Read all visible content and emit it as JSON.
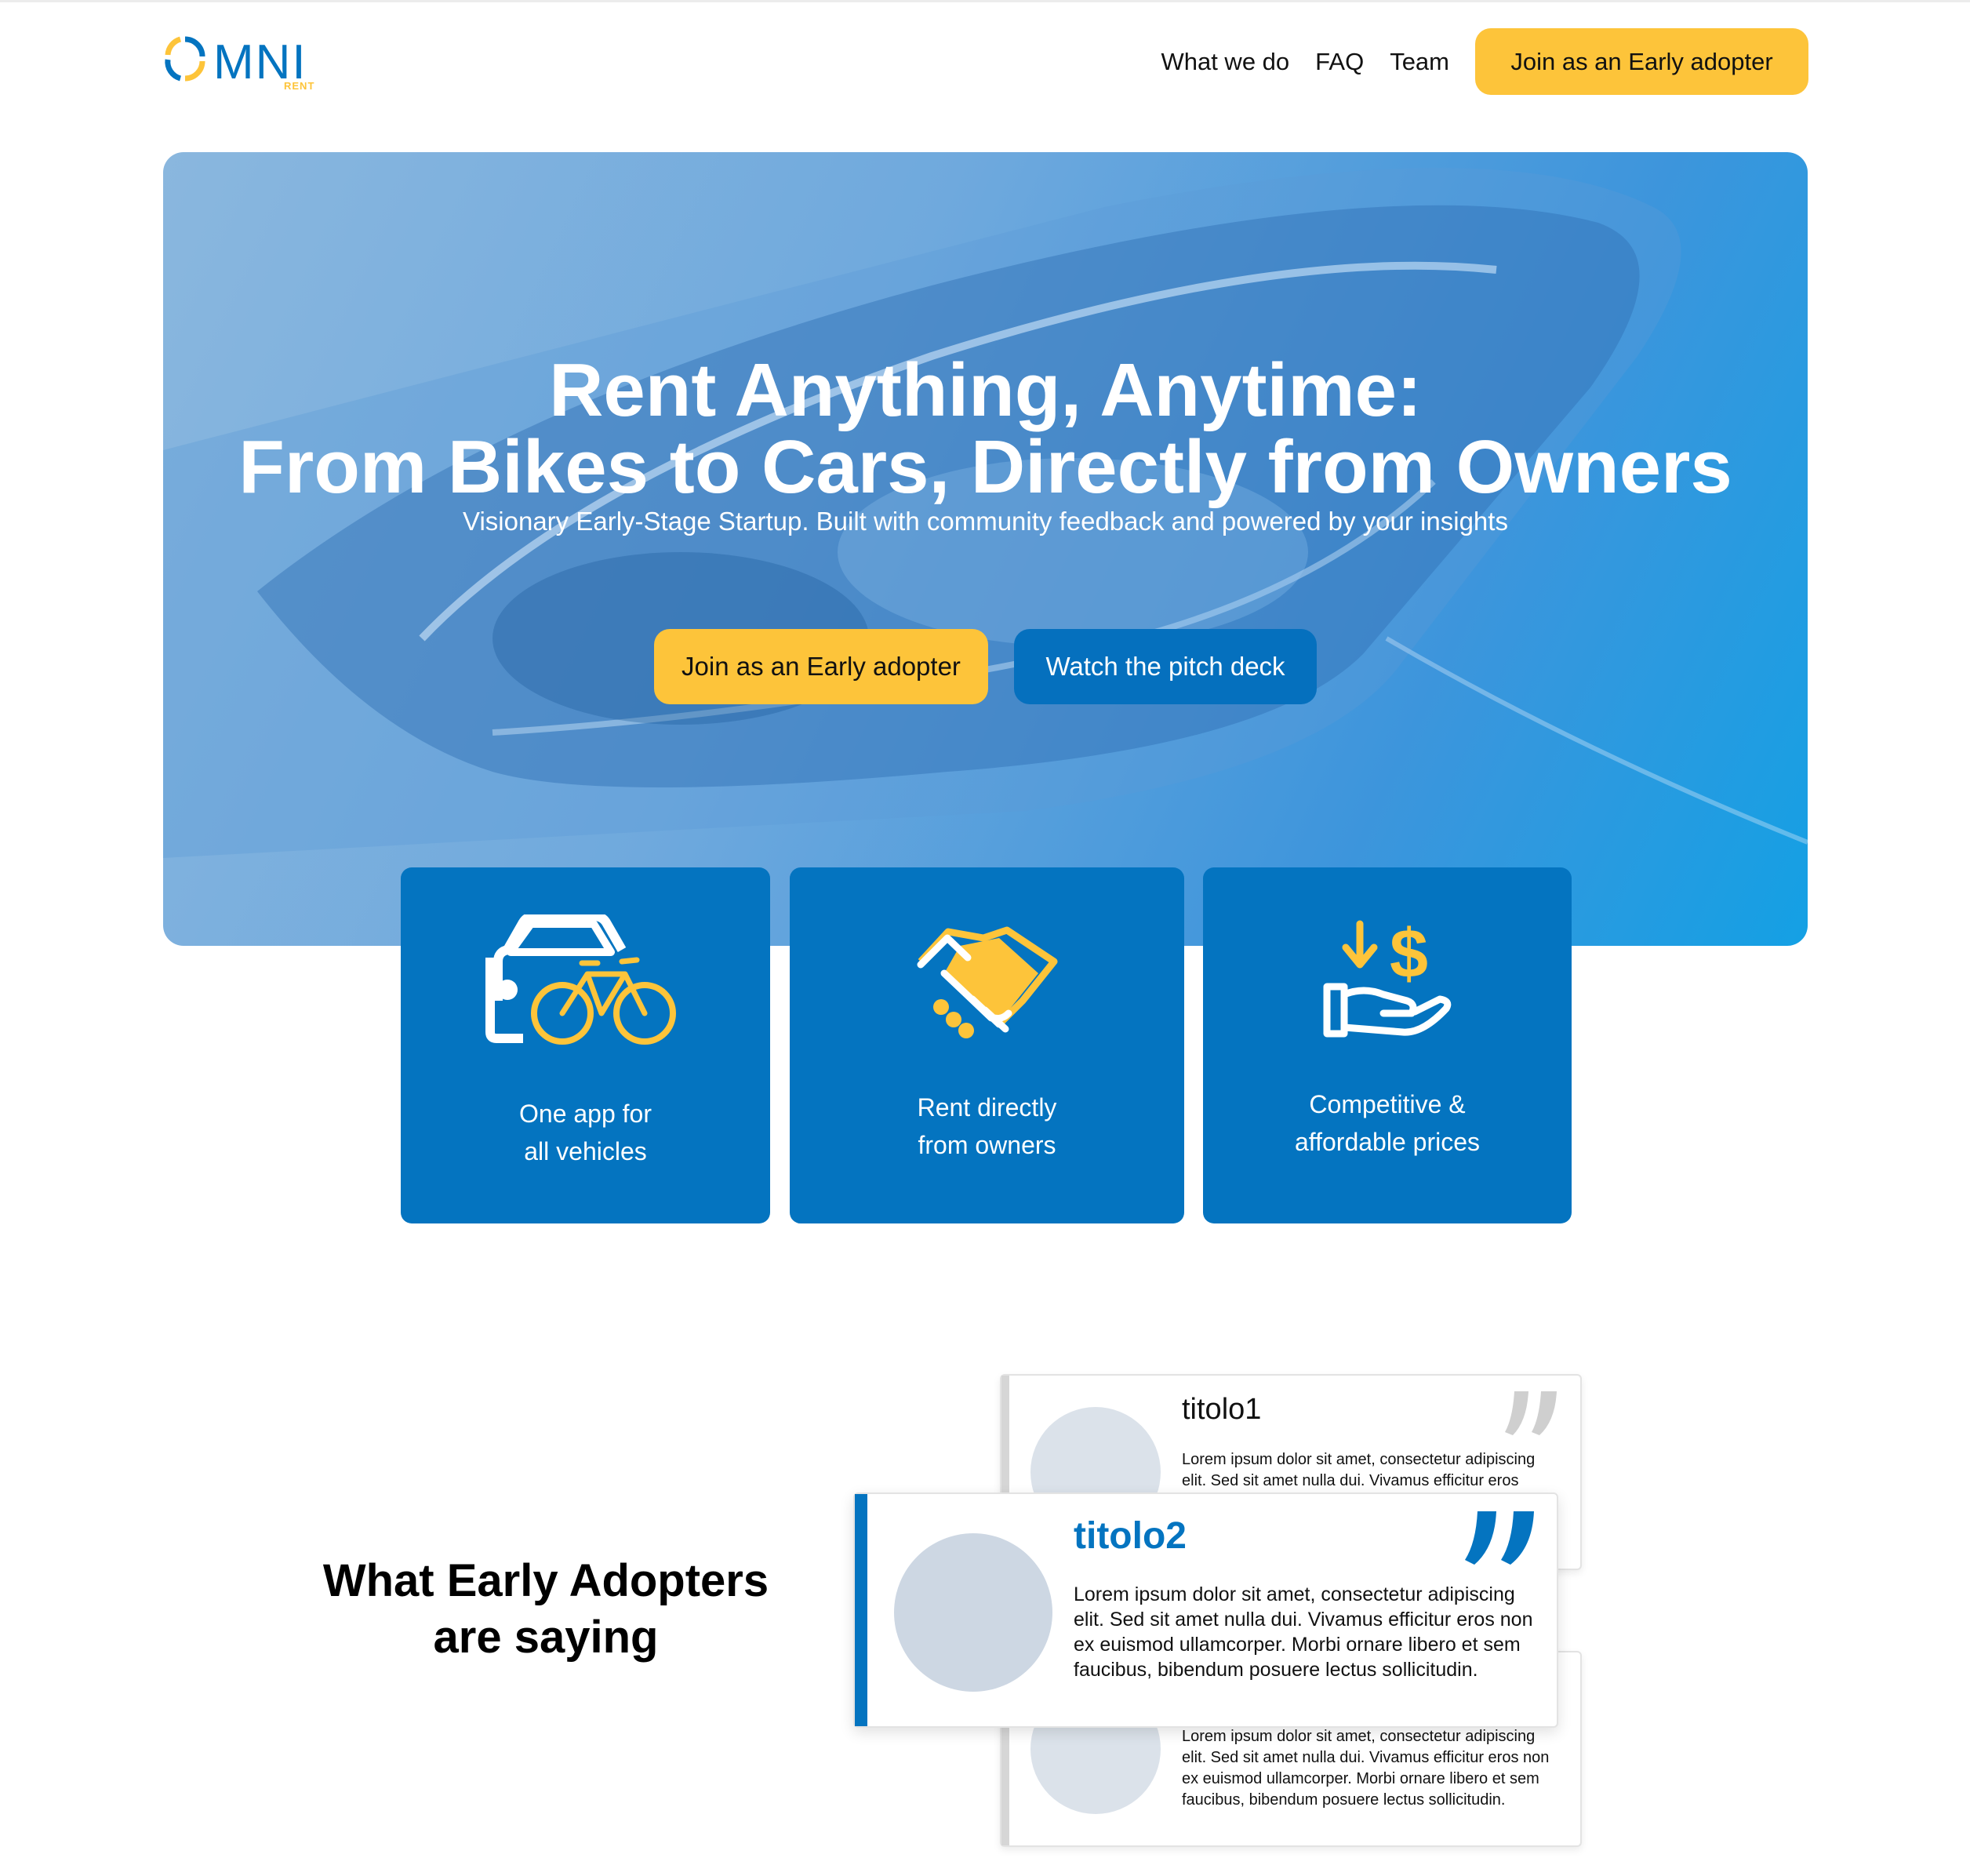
{
  "brand": {
    "name": "OMNI",
    "tagline": "RENT",
    "primary_color": "#0474c0",
    "accent_color": "#fdc43a"
  },
  "nav": {
    "links": [
      "What we do",
      "FAQ",
      "Team"
    ],
    "cta": "Join as an Early adopter"
  },
  "hero": {
    "title_line1": "Rent Anything, Anytime:",
    "title_line2": "From Bikes to Cars, Directly from Owners",
    "subtitle": "Visionary Early-Stage Startup. Built with community feedback and powered by your insights",
    "primary_cta": "Join as an Early adopter",
    "secondary_cta": "Watch the pitch deck"
  },
  "features": [
    {
      "icon": "car-bike-icon",
      "line1": "One app for",
      "line2": "all vehicles"
    },
    {
      "icon": "handshake-icon",
      "line1": "Rent directly",
      "line2": "from owners"
    },
    {
      "icon": "price-hand-icon",
      "line1": "Competitive &",
      "line2": "affordable prices"
    }
  ],
  "testimonials": {
    "heading_line1": "What Early Adopters",
    "heading_line2": "are saying",
    "items": [
      {
        "title": "titolo1",
        "text": "Lorem ipsum dolor sit amet, consectetur adipiscing elit. Sed sit amet nulla dui. Vivamus efficitur eros"
      },
      {
        "title": "titolo2",
        "text": "Lorem ipsum dolor sit amet, consectetur adipiscing elit. Sed sit amet nulla dui. Vivamus efficitur eros non ex euismod ullamcorper. Morbi ornare libero et sem faucibus, bibendum posuere lectus sollicitudin."
      },
      {
        "title": "",
        "text": "Lorem ipsum dolor sit amet, consectetur adipiscing elit. Sed sit amet nulla dui. Vivamus efficitur eros non ex euismod ullamcorper. Morbi ornare libero et sem faucibus, bibendum posuere lectus sollicitudin."
      }
    ]
  }
}
